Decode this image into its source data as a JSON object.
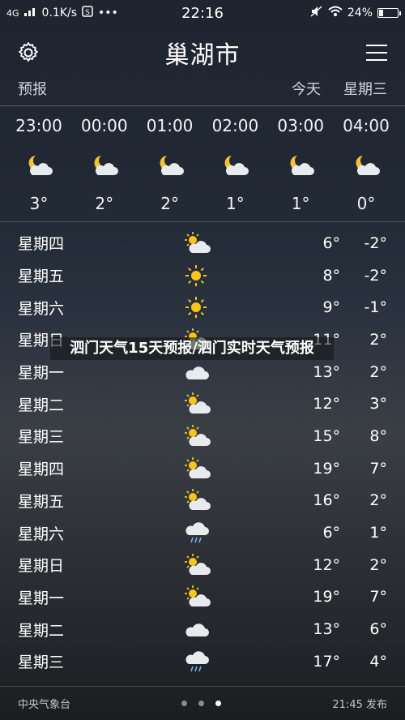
{
  "status": {
    "network": "4G",
    "speed": "0.1K/s",
    "time": "22:16",
    "battery": "24%",
    "battery_level": 0.24
  },
  "header": {
    "city": "巢湖市"
  },
  "subheader": {
    "label": "预报",
    "today": "今天",
    "weekday": "星期三"
  },
  "hourly": [
    {
      "time": "23:00",
      "icon": "moon-cloud-icon",
      "temp": "3°"
    },
    {
      "time": "00:00",
      "icon": "moon-cloud-icon",
      "temp": "2°"
    },
    {
      "time": "01:00",
      "icon": "moon-cloud-icon",
      "temp": "2°"
    },
    {
      "time": "02:00",
      "icon": "moon-cloud-icon",
      "temp": "1°"
    },
    {
      "time": "03:00",
      "icon": "moon-cloud-icon",
      "temp": "1°"
    },
    {
      "time": "04:00",
      "icon": "moon-cloud-icon",
      "temp": "0°"
    }
  ],
  "daily": [
    {
      "day": "星期四",
      "icon": "sun-cloud-icon",
      "high": "6°",
      "low": "-2°"
    },
    {
      "day": "星期五",
      "icon": "sun-icon",
      "high": "8°",
      "low": "-2°"
    },
    {
      "day": "星期六",
      "icon": "sun-icon",
      "high": "9°",
      "low": "-1°"
    },
    {
      "day": "星期日",
      "icon": "sun-cloud-icon",
      "high": "11°",
      "low": "2°"
    },
    {
      "day": "星期一",
      "icon": "cloud-icon",
      "high": "13°",
      "low": "2°"
    },
    {
      "day": "星期二",
      "icon": "sun-cloud-icon",
      "high": "12°",
      "low": "3°"
    },
    {
      "day": "星期三",
      "icon": "sun-cloud-icon",
      "high": "15°",
      "low": "8°"
    },
    {
      "day": "星期四",
      "icon": "sun-cloud-icon",
      "high": "19°",
      "low": "7°"
    },
    {
      "day": "星期五",
      "icon": "sun-cloud-icon",
      "high": "16°",
      "low": "2°"
    },
    {
      "day": "星期六",
      "icon": "rain-cloud-icon",
      "high": "6°",
      "low": "1°"
    },
    {
      "day": "星期日",
      "icon": "sun-cloud-icon",
      "high": "12°",
      "low": "2°"
    },
    {
      "day": "星期一",
      "icon": "sun-cloud-icon",
      "high": "19°",
      "low": "7°"
    },
    {
      "day": "星期二",
      "icon": "cloud-icon",
      "high": "13°",
      "low": "6°"
    },
    {
      "day": "星期三",
      "icon": "rain-cloud-icon",
      "high": "17°",
      "low": "4°"
    }
  ],
  "footer": {
    "source": "中央气象台",
    "published": "21:45 发布",
    "pages": 3,
    "active_page": 3
  },
  "overlay": {
    "title": "泗门天气15天预报/泗门实时天气预报"
  }
}
